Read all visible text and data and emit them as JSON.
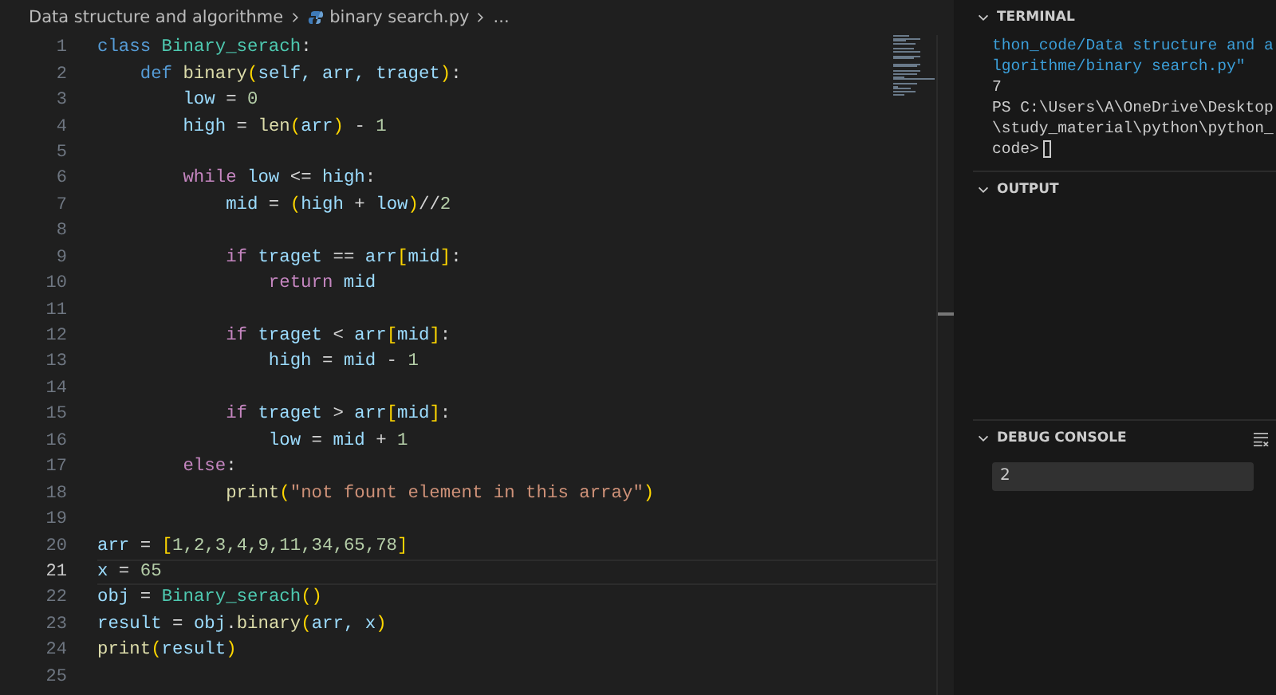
{
  "breadcrumb": {
    "folder": "Data structure and algorithme",
    "file": "binary search.py",
    "more": "..."
  },
  "editor": {
    "lines": [
      {
        "number": "1",
        "selected": false,
        "tokens": [
          {
            "text": "class ",
            "kind": "keyword"
          },
          {
            "text": "Binary_serach",
            "kind": "class"
          },
          {
            "text": ":",
            "kind": "plain"
          }
        ]
      },
      {
        "number": "2",
        "selected": false,
        "tokens": [
          {
            "text": "    def ",
            "kind": "keyword"
          },
          {
            "text": "binary",
            "kind": "func"
          },
          {
            "text": "(",
            "kind": "bracket"
          },
          {
            "text": "self, arr, traget",
            "kind": "var"
          },
          {
            "text": ")",
            "kind": "bracket"
          },
          {
            "text": ":",
            "kind": "plain"
          }
        ]
      },
      {
        "number": "3",
        "selected": false,
        "tokens": [
          {
            "text": "        low",
            "kind": "var"
          },
          {
            "text": " = ",
            "kind": "plain"
          },
          {
            "text": "0",
            "kind": "num"
          }
        ]
      },
      {
        "number": "4",
        "selected": false,
        "tokens": [
          {
            "text": "        high",
            "kind": "var"
          },
          {
            "text": " = ",
            "kind": "plain"
          },
          {
            "text": "len",
            "kind": "func"
          },
          {
            "text": "(",
            "kind": "bracket"
          },
          {
            "text": "arr",
            "kind": "var"
          },
          {
            "text": ")",
            "kind": "bracket"
          },
          {
            "text": " - ",
            "kind": "plain"
          },
          {
            "text": "1",
            "kind": "num"
          }
        ]
      },
      {
        "number": "5",
        "selected": false
      },
      {
        "number": "6",
        "selected": false,
        "tokens": [
          {
            "text": "        while ",
            "kind": "control"
          },
          {
            "text": "low",
            "kind": "var"
          },
          {
            "text": " <= ",
            "kind": "plain"
          },
          {
            "text": "high",
            "kind": "var"
          },
          {
            "text": ":",
            "kind": "plain"
          }
        ]
      },
      {
        "number": "7",
        "selected": false,
        "tokens": [
          {
            "text": "            mid",
            "kind": "var"
          },
          {
            "text": " = ",
            "kind": "plain"
          },
          {
            "text": "(",
            "kind": "bracket"
          },
          {
            "text": "high",
            "kind": "var"
          },
          {
            "text": " + ",
            "kind": "plain"
          },
          {
            "text": "low",
            "kind": "var"
          },
          {
            "text": ")",
            "kind": "bracket"
          },
          {
            "text": "//",
            "kind": "plain"
          },
          {
            "text": "2",
            "kind": "num"
          }
        ]
      },
      {
        "number": "8",
        "selected": false
      },
      {
        "number": "9",
        "selected": false,
        "tokens": [
          {
            "text": "            if ",
            "kind": "control"
          },
          {
            "text": "traget",
            "kind": "var"
          },
          {
            "text": " == ",
            "kind": "plain"
          },
          {
            "text": "arr",
            "kind": "var"
          },
          {
            "text": "[",
            "kind": "bracket"
          },
          {
            "text": "mid",
            "kind": "var"
          },
          {
            "text": "]",
            "kind": "bracket"
          },
          {
            "text": ":",
            "kind": "plain"
          }
        ]
      },
      {
        "number": "10",
        "selected": false,
        "tokens": [
          {
            "text": "                return ",
            "kind": "control"
          },
          {
            "text": "mid",
            "kind": "var"
          }
        ]
      },
      {
        "number": "11",
        "selected": false
      },
      {
        "number": "12",
        "selected": false,
        "tokens": [
          {
            "text": "            if ",
            "kind": "control"
          },
          {
            "text": "traget",
            "kind": "var"
          },
          {
            "text": " < ",
            "kind": "plain"
          },
          {
            "text": "arr",
            "kind": "var"
          },
          {
            "text": "[",
            "kind": "bracket"
          },
          {
            "text": "mid",
            "kind": "var"
          },
          {
            "text": "]",
            "kind": "bracket"
          },
          {
            "text": ":",
            "kind": "plain"
          }
        ]
      },
      {
        "number": "13",
        "selected": false,
        "tokens": [
          {
            "text": "                high",
            "kind": "var"
          },
          {
            "text": " = ",
            "kind": "plain"
          },
          {
            "text": "mid",
            "kind": "var"
          },
          {
            "text": " - ",
            "kind": "plain"
          },
          {
            "text": "1",
            "kind": "num"
          }
        ]
      },
      {
        "number": "14",
        "selected": false
      },
      {
        "number": "15",
        "selected": false,
        "tokens": [
          {
            "text": "            if ",
            "kind": "control"
          },
          {
            "text": "traget",
            "kind": "var"
          },
          {
            "text": " > ",
            "kind": "plain"
          },
          {
            "text": "arr",
            "kind": "var"
          },
          {
            "text": "[",
            "kind": "bracket"
          },
          {
            "text": "mid",
            "kind": "var"
          },
          {
            "text": "]",
            "kind": "bracket"
          },
          {
            "text": ":",
            "kind": "plain"
          }
        ]
      },
      {
        "number": "16",
        "selected": false,
        "tokens": [
          {
            "text": "                low",
            "kind": "var"
          },
          {
            "text": " = ",
            "kind": "plain"
          },
          {
            "text": "mid",
            "kind": "var"
          },
          {
            "text": " + ",
            "kind": "plain"
          },
          {
            "text": "1",
            "kind": "num"
          }
        ]
      },
      {
        "number": "17",
        "selected": false,
        "tokens": [
          {
            "text": "        else",
            "kind": "control"
          },
          {
            "text": ":",
            "kind": "plain"
          }
        ]
      },
      {
        "number": "18",
        "selected": false,
        "tokens": [
          {
            "text": "            print",
            "kind": "func"
          },
          {
            "text": "(",
            "kind": "bracket"
          },
          {
            "text": "\"not fount element in this array\"",
            "kind": "str"
          },
          {
            "text": ")",
            "kind": "bracket"
          }
        ]
      },
      {
        "number": "19",
        "selected": false
      },
      {
        "number": "20",
        "selected": false,
        "tokens": [
          {
            "text": "arr",
            "kind": "var"
          },
          {
            "text": " = ",
            "kind": "plain"
          },
          {
            "text": "[",
            "kind": "bracket"
          },
          {
            "text": "1,2,3,4,9,11,34,65,78",
            "kind": "num"
          },
          {
            "text": "]",
            "kind": "bracket"
          }
        ]
      },
      {
        "number": "21",
        "selected": true,
        "tokens": [
          {
            "text": "x",
            "kind": "var"
          },
          {
            "text": " = ",
            "kind": "plain"
          },
          {
            "text": "65",
            "kind": "num"
          }
        ]
      },
      {
        "number": "22",
        "selected": false,
        "tokens": [
          {
            "text": "obj",
            "kind": "var"
          },
          {
            "text": " = ",
            "kind": "plain"
          },
          {
            "text": "Binary_serach",
            "kind": "class"
          },
          {
            "text": "()",
            "kind": "bracket"
          }
        ]
      },
      {
        "number": "23",
        "selected": false,
        "tokens": [
          {
            "text": "result",
            "kind": "var"
          },
          {
            "text": " = ",
            "kind": "plain"
          },
          {
            "text": "obj",
            "kind": "var"
          },
          {
            "text": ".",
            "kind": "plain"
          },
          {
            "text": "binary",
            "kind": "func"
          },
          {
            "text": "(",
            "kind": "bracket"
          },
          {
            "text": "arr, x",
            "kind": "var"
          },
          {
            "text": ")",
            "kind": "bracket"
          }
        ]
      },
      {
        "number": "24",
        "selected": false,
        "tokens": [
          {
            "text": "print",
            "kind": "func"
          },
          {
            "text": "(",
            "kind": "bracket"
          },
          {
            "text": "result",
            "kind": "var"
          },
          {
            "text": ")",
            "kind": "bracket"
          }
        ]
      },
      {
        "number": "25",
        "selected": false
      }
    ]
  },
  "panels": [
    {
      "kind": "terminal",
      "title": "TERMINAL",
      "expanded": true,
      "lines": [
        {
          "text": "thon_code/Data structure and a",
          "kind": "command"
        },
        {
          "text": "lgorithme/binary search.py\"",
          "kind": "command"
        },
        {
          "text": "7",
          "kind": "output"
        },
        {
          "text": "PS C:\\Users\\A\\OneDrive\\Desktop",
          "kind": "output"
        },
        {
          "text": "\\study_material\\python\\python_",
          "kind": "output"
        },
        {
          "text": "code>",
          "kind": "prompt"
        }
      ]
    },
    {
      "kind": "output",
      "title": "OUTPUT",
      "expanded": true
    },
    {
      "kind": "debug",
      "title": "DEBUG CONSOLE",
      "expanded": true,
      "input": "2"
    }
  ]
}
